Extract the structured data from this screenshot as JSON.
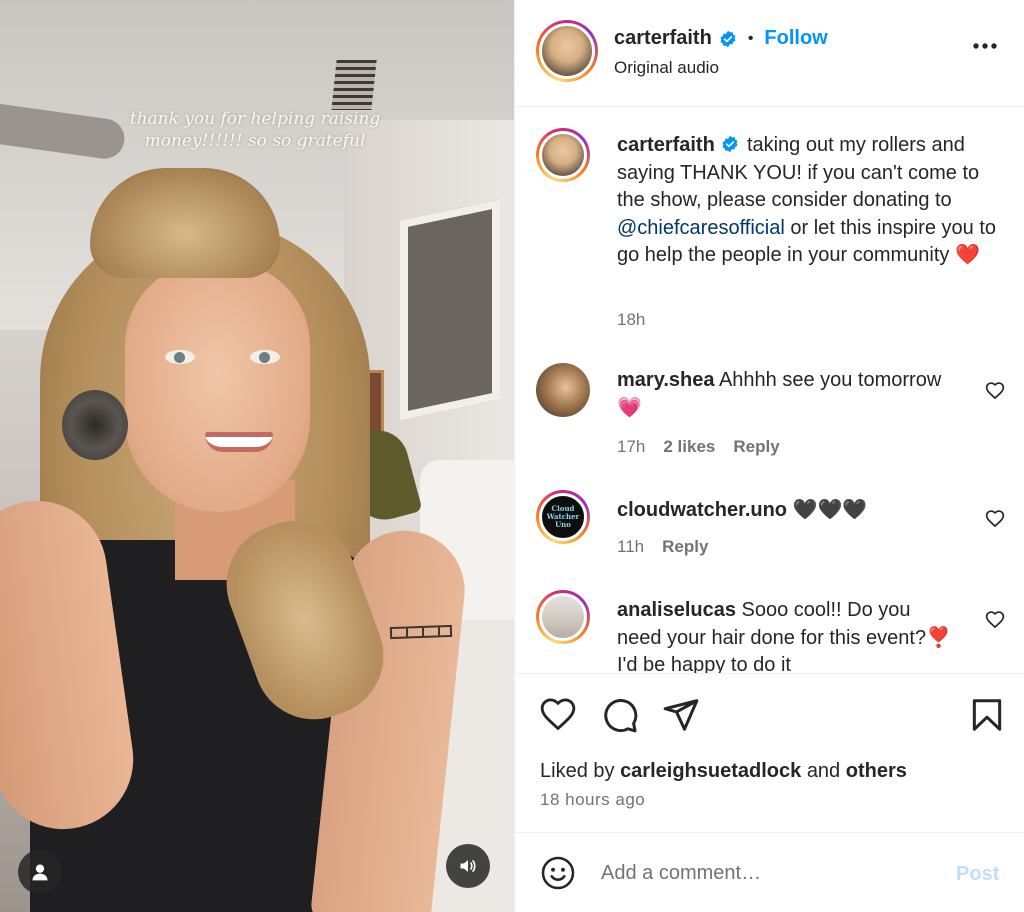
{
  "media": {
    "overlay_caption_line1": "thank you for helping raising",
    "overlay_caption_line2": "money!!!!!! so so grateful",
    "user_tag_icon": "user-icon",
    "sound_icon": "speaker-icon"
  },
  "header": {
    "username": "carterfaith",
    "verified": true,
    "separator": "•",
    "follow_label": "Follow",
    "audio_label": "Original audio",
    "more_label": "•••"
  },
  "caption": {
    "username": "carterfaith",
    "text_before": "taking out my rollers and saying THANK YOU! if you can't come to the show, please consider donating to ",
    "mention": "@chiefcaresofficial",
    "text_after": " or let this inspire you to go help the people in your community",
    "emoji": "❤️",
    "time": "18h"
  },
  "comments": [
    {
      "username": "mary.shea",
      "text": "Ahhhh see you tomorrow 💗",
      "time": "17h",
      "likes": "2 likes",
      "reply": "Reply"
    },
    {
      "username": "cloudwatcher.uno",
      "text": "🖤🖤🖤",
      "time": "11h",
      "reply": "Reply",
      "avatar_text": "Cloud Watcher Uno"
    },
    {
      "username": "analiselucas",
      "text": "Sooo cool!! Do you need your hair done for this event?❣️ I'd be happy to do it"
    }
  ],
  "footer": {
    "liked_by_prefix": "Liked by",
    "liked_by_user": "carleighsuetadlock",
    "liked_by_and": "and",
    "liked_by_others": "others",
    "time_ago": "18 hours ago",
    "comment_placeholder": "Add a comment…",
    "post_label": "Post"
  },
  "colors": {
    "accent": "#0095f6",
    "mention": "#00376b",
    "muted": "#737373",
    "post_disabled": "#c0dffd"
  }
}
